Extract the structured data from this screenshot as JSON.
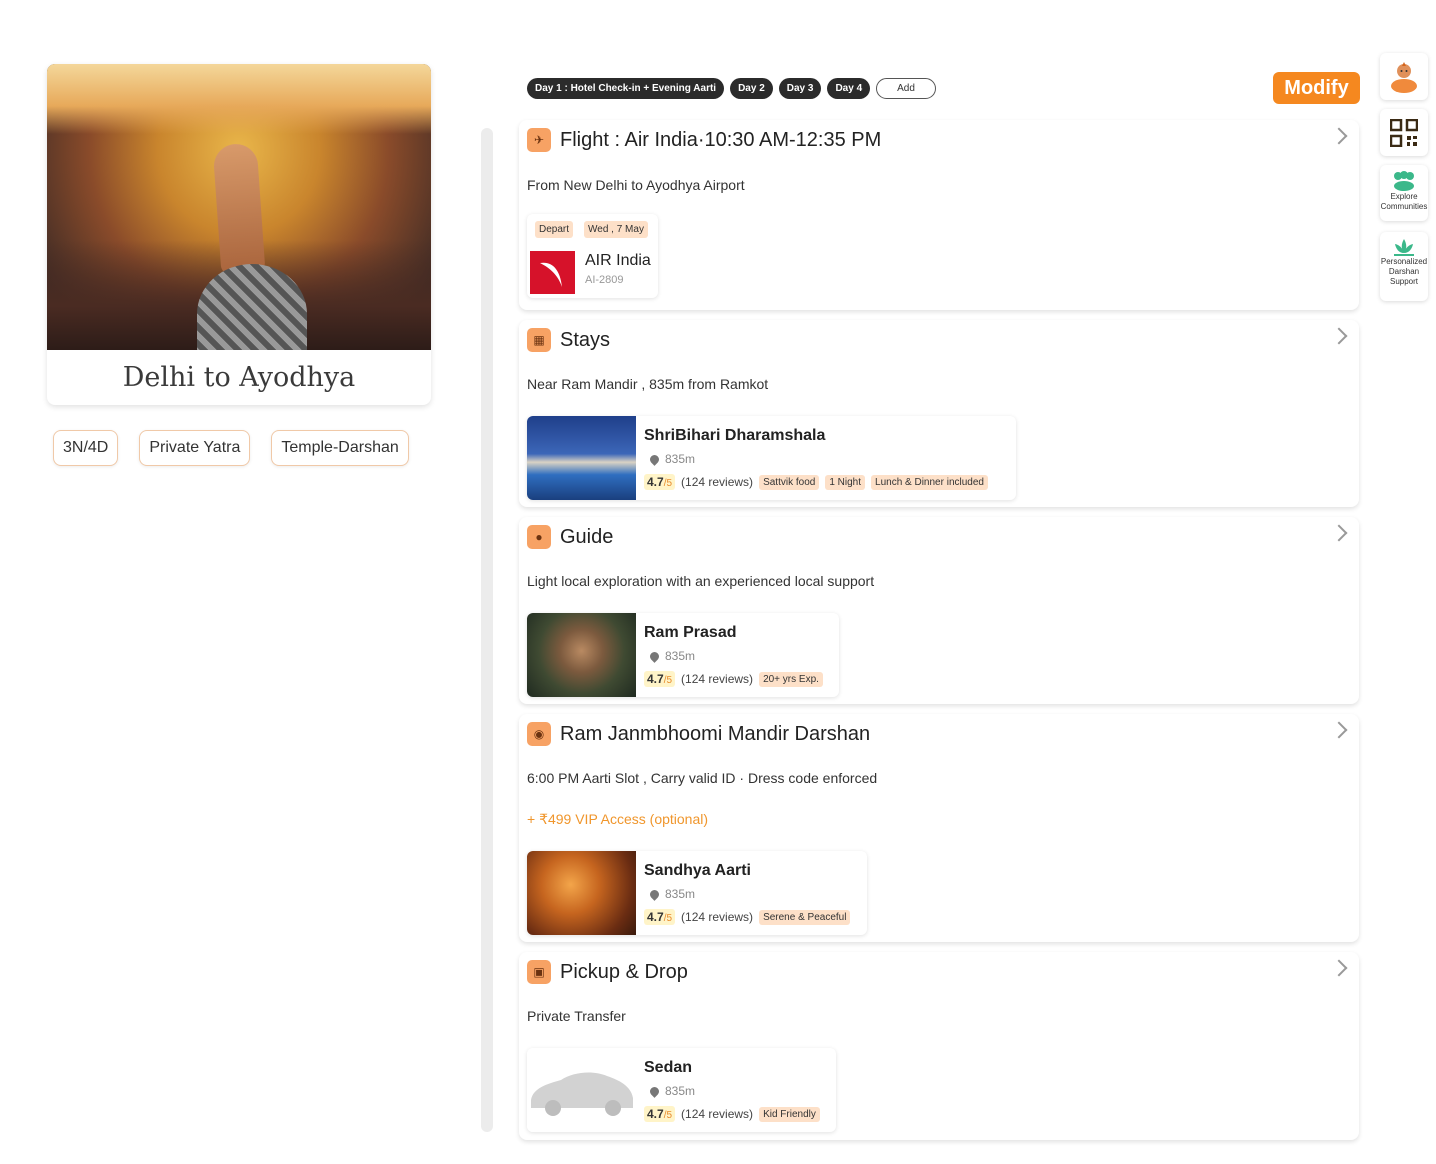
{
  "hero": {
    "title": "Delhi to Ayodhya"
  },
  "tags": [
    "3N/4D",
    "Private Yatra",
    "Temple-Darshan"
  ],
  "days": [
    "Day 1 : Hotel Check-in + Evening Aarti",
    "Day 2",
    "Day 3",
    "Day 4"
  ],
  "add_label": "Add",
  "modify_label": "Modify",
  "tools": {
    "communities": "Explore Communities",
    "darshan": "Personalized Darshan Support"
  },
  "flight": {
    "title": "Flight : Air India·10:30 AM-12:35 PM",
    "desc": "From New Delhi to Ayodhya Airport",
    "chip_depart": "Depart",
    "chip_date": "Wed , 7 May",
    "airline": "AIR India",
    "code": "AI-2809"
  },
  "stays": {
    "title": "Stays",
    "desc": "Near Ram Mandir , 835m from Ramkot",
    "name": "ShriBihari Dharamshala",
    "dist": "835m",
    "rating": "4.7",
    "of": "/5",
    "reviews": "(124 reviews)",
    "chips": [
      "Sattvik food",
      "1 Night",
      "Lunch & Dinner included"
    ]
  },
  "guide": {
    "title": "Guide",
    "desc": "Light local exploration with an experienced local support",
    "name": "Ram Prasad",
    "dist": "835m",
    "rating": "4.7",
    "of": "/5",
    "reviews": "(124 reviews)",
    "chips": [
      "20+ yrs Exp."
    ]
  },
  "darshan": {
    "title": "Ram Janmbhoomi Mandir Darshan",
    "desc": "6:00 PM Aarti Slot  , Carry valid ID · Dress code enforced",
    "extra": "+ ₹499 VIP Access (optional)",
    "name": "Sandhya Aarti",
    "dist": "835m",
    "rating": "4.7",
    "of": "/5",
    "reviews": "(124 reviews)",
    "chips": [
      "Serene & Peaceful"
    ]
  },
  "pickup": {
    "title": "Pickup & Drop",
    "desc": "Private Transfer",
    "name": "Sedan",
    "dist": "835m",
    "rating": "4.7",
    "of": "/5",
    "reviews": "(124 reviews)",
    "chips": [
      "Kid Friendly"
    ]
  },
  "colors": {
    "accent": "#f5881f",
    "chip": "#fde0c8",
    "icon_bg": "#f7a264"
  }
}
